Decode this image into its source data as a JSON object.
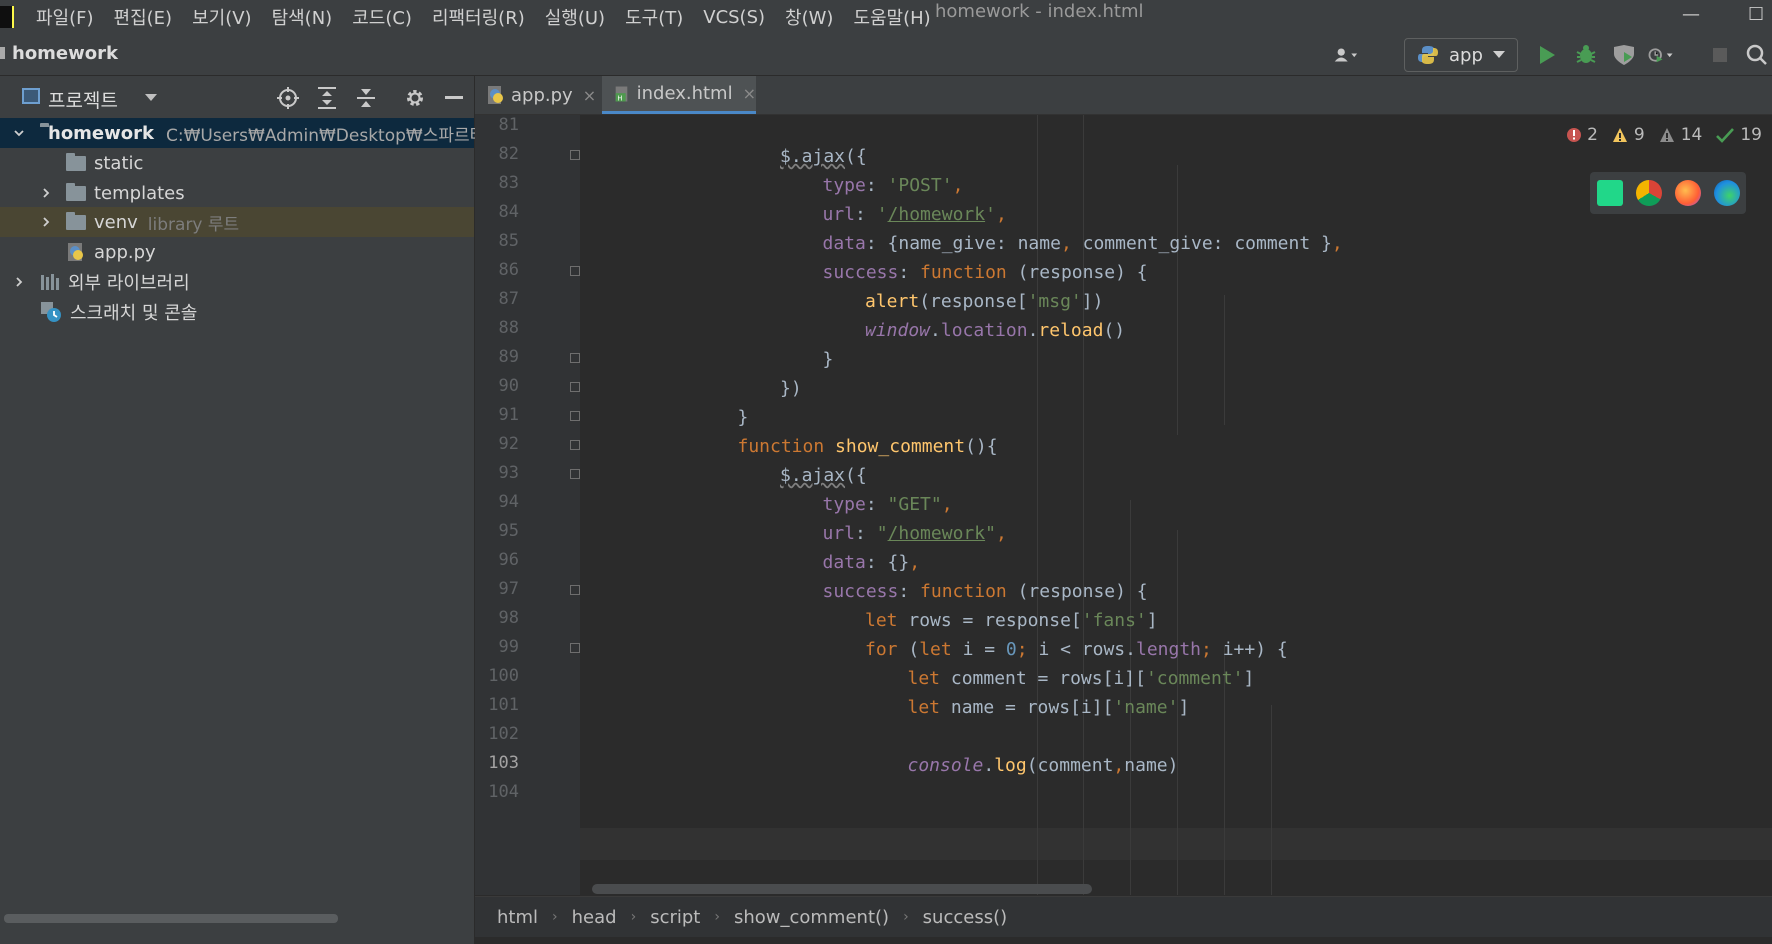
{
  "menu": [
    "파일(F)",
    "편집(E)",
    "보기(V)",
    "탐색(N)",
    "코드(C)",
    "리팩터링(R)",
    "실행(U)",
    "도구(T)",
    "VCS(S)",
    "창(W)",
    "도움말(H)"
  ],
  "window_title": "homework - index.html",
  "nav": {
    "project_name": "homework",
    "run_config": "app"
  },
  "project_panel": {
    "title": "프로젝트",
    "tree": [
      {
        "label": "homework",
        "extra": "C:₩Users₩Admin₩Desktop₩스파르타"
      },
      {
        "label": "static"
      },
      {
        "label": "templates"
      },
      {
        "label": "venv",
        "extra": "library 루트"
      },
      {
        "label": "app.py"
      },
      {
        "label": "외부 라이브러리"
      },
      {
        "label": "스크래치 및 콘솔"
      }
    ]
  },
  "tabs": [
    {
      "label": "app.py",
      "close": "×"
    },
    {
      "label": "index.html",
      "close": "×"
    }
  ],
  "inspections": {
    "errors": "2",
    "warnings": "9",
    "weak_warnings": "14",
    "typos": "19"
  },
  "line_numbers": [
    "81",
    "82",
    "83",
    "84",
    "85",
    "86",
    "87",
    "88",
    "89",
    "90",
    "91",
    "92",
    "93",
    "94",
    "95",
    "96",
    "97",
    "98",
    "99",
    "100",
    "101",
    "102",
    "103",
    "104"
  ],
  "breadcrumb": [
    "html",
    "head",
    "script",
    "show_comment()",
    "success()"
  ],
  "colors": {
    "accent": "#4a88c7",
    "keyword": "#cc7832",
    "string": "#6a8759",
    "function": "#ffc66d",
    "property": "#9876aa",
    "number": "#6897bb"
  }
}
